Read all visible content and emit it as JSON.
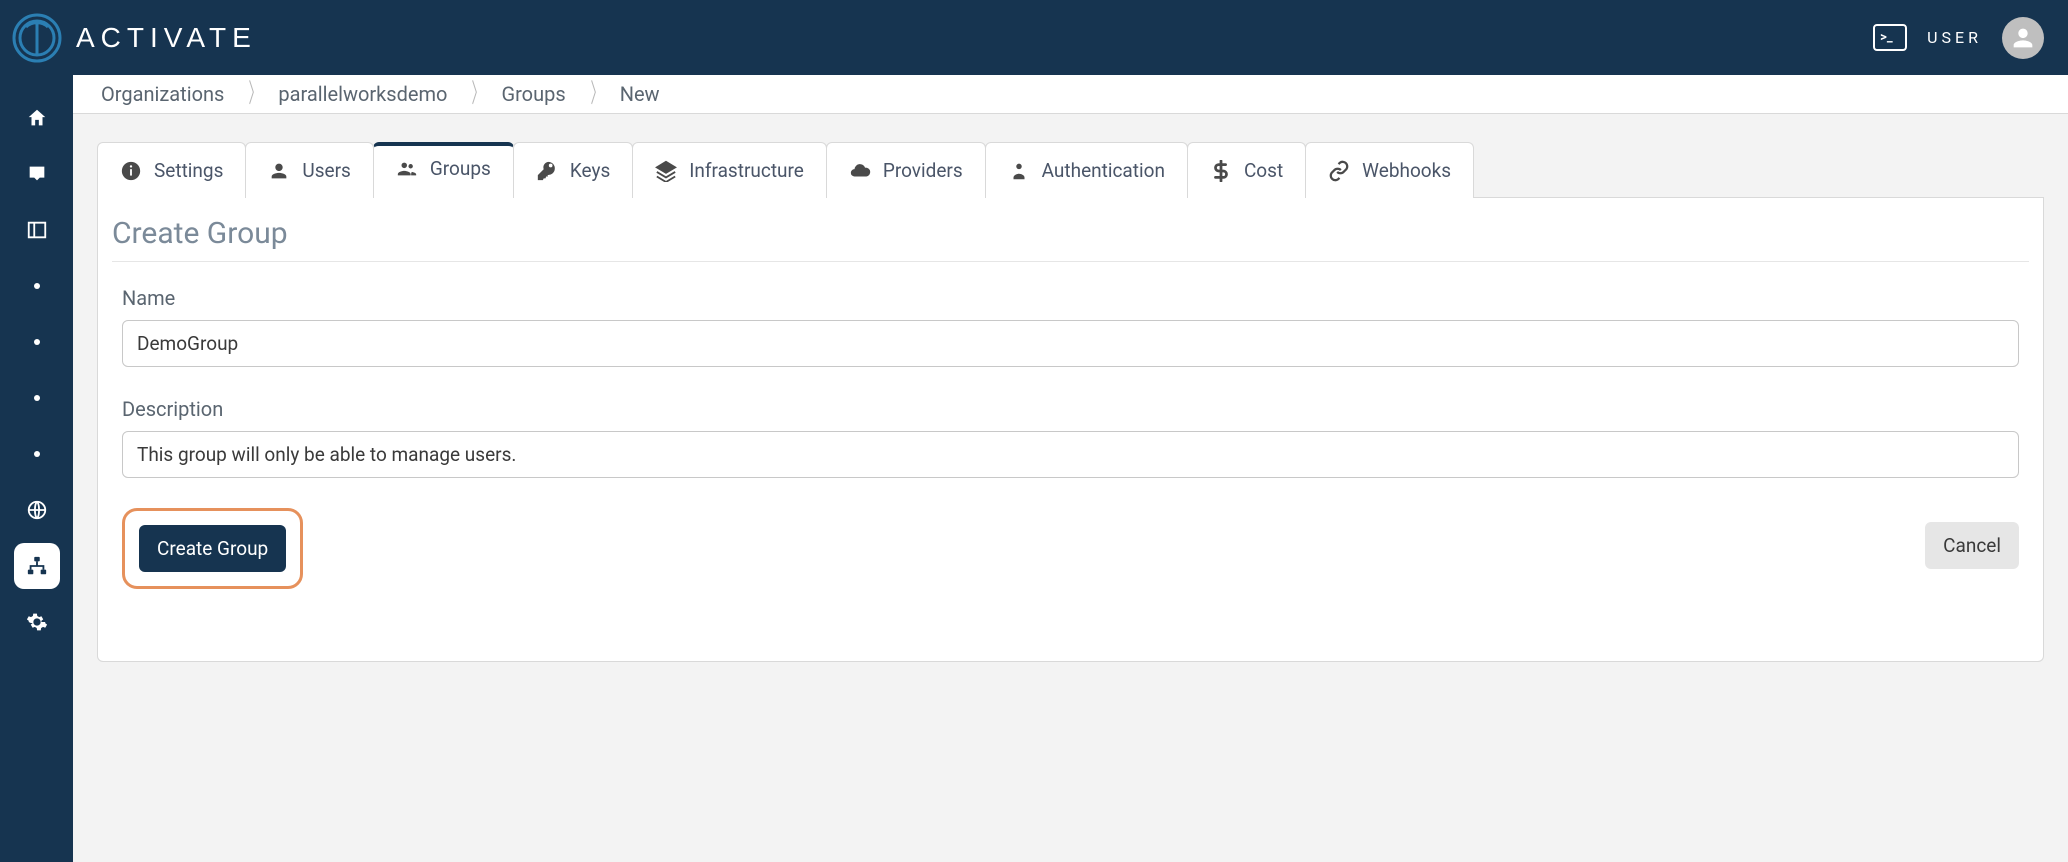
{
  "brand": "ACTIVATE",
  "topbar": {
    "user_label": "USER"
  },
  "breadcrumbs": [
    "Organizations",
    "parallelworksdemo",
    "Groups",
    "New"
  ],
  "tabs": [
    {
      "icon": "info",
      "label": "Settings"
    },
    {
      "icon": "user",
      "label": "Users"
    },
    {
      "icon": "group",
      "label": "Groups",
      "active": true
    },
    {
      "icon": "key",
      "label": "Keys"
    },
    {
      "icon": "layers",
      "label": "Infrastructure"
    },
    {
      "icon": "cloud",
      "label": "Providers"
    },
    {
      "icon": "shield-user",
      "label": "Authentication"
    },
    {
      "icon": "dollar",
      "label": "Cost"
    },
    {
      "icon": "link",
      "label": "Webhooks"
    }
  ],
  "panel": {
    "title": "Create Group",
    "name_label": "Name",
    "name_value": "DemoGroup",
    "description_label": "Description",
    "description_value": "This group will only be able to manage users.",
    "create_button": "Create Group",
    "cancel_button": "Cancel"
  }
}
